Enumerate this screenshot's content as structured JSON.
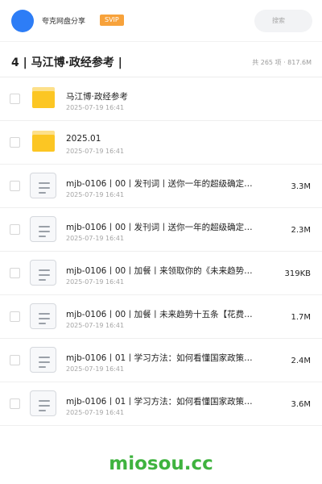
{
  "header": {
    "app_title": "夸克网盘分享",
    "svip_badge": "SVIP",
    "search_placeholder": "搜索"
  },
  "folder": {
    "title": "4 | 马江博·政经参考 |",
    "stats": "共 265 项 · 817.6M"
  },
  "files": [
    {
      "type": "folder",
      "name": "马江博·政经参考",
      "date": "2025-07-19 16:41",
      "size": ""
    },
    {
      "type": "folder",
      "name": "2025.01",
      "date": "2025-07-19 16:41",
      "size": ""
    },
    {
      "type": "doc",
      "name": "mjb-0106丨00丨发刊词丨送你一年的超级确定…",
      "date": "2025-07-19 16:41",
      "size": "3.3M"
    },
    {
      "type": "doc",
      "name": "mjb-0106丨00丨发刊词丨送你一年的超级确定…",
      "date": "2025-07-19 16:41",
      "size": "2.3M"
    },
    {
      "type": "doc",
      "name": "mjb-0106丨00丨加餐丨来领取你的《未来趋势…",
      "date": "2025-07-19 16:41",
      "size": "319KB"
    },
    {
      "type": "doc",
      "name": "mjb-0106丨00丨加餐丨未来趋势十五条【花费…",
      "date": "2025-07-19 16:41",
      "size": "1.7M"
    },
    {
      "type": "doc",
      "name": "mjb-0106丨01丨学习方法：如何看懂国家政策…",
      "date": "2025-07-19 16:41",
      "size": "2.4M"
    },
    {
      "type": "doc",
      "name": "mjb-0106丨01丨学习方法：如何看懂国家政策…",
      "date": "2025-07-19 16:41",
      "size": "3.6M"
    }
  ],
  "watermark": "miosou.cc"
}
